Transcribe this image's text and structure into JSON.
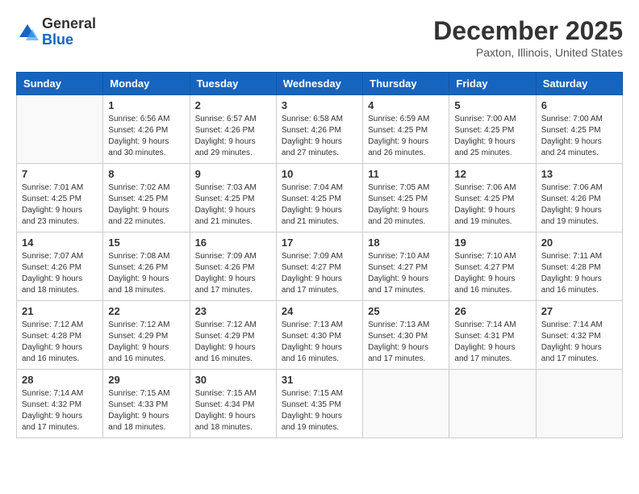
{
  "header": {
    "logo_line1": "General",
    "logo_line2": "Blue",
    "month": "December 2025",
    "location": "Paxton, Illinois, United States"
  },
  "days_of_week": [
    "Sunday",
    "Monday",
    "Tuesday",
    "Wednesday",
    "Thursday",
    "Friday",
    "Saturday"
  ],
  "weeks": [
    [
      {
        "day": "",
        "sunrise": "",
        "sunset": "",
        "daylight": "",
        "empty": true
      },
      {
        "day": "1",
        "sunrise": "6:56 AM",
        "sunset": "4:26 PM",
        "daylight": "9 hours and 30 minutes."
      },
      {
        "day": "2",
        "sunrise": "6:57 AM",
        "sunset": "4:26 PM",
        "daylight": "9 hours and 29 minutes."
      },
      {
        "day": "3",
        "sunrise": "6:58 AM",
        "sunset": "4:26 PM",
        "daylight": "9 hours and 27 minutes."
      },
      {
        "day": "4",
        "sunrise": "6:59 AM",
        "sunset": "4:25 PM",
        "daylight": "9 hours and 26 minutes."
      },
      {
        "day": "5",
        "sunrise": "7:00 AM",
        "sunset": "4:25 PM",
        "daylight": "9 hours and 25 minutes."
      },
      {
        "day": "6",
        "sunrise": "7:00 AM",
        "sunset": "4:25 PM",
        "daylight": "9 hours and 24 minutes."
      }
    ],
    [
      {
        "day": "7",
        "sunrise": "7:01 AM",
        "sunset": "4:25 PM",
        "daylight": "9 hours and 23 minutes."
      },
      {
        "day": "8",
        "sunrise": "7:02 AM",
        "sunset": "4:25 PM",
        "daylight": "9 hours and 22 minutes."
      },
      {
        "day": "9",
        "sunrise": "7:03 AM",
        "sunset": "4:25 PM",
        "daylight": "9 hours and 21 minutes."
      },
      {
        "day": "10",
        "sunrise": "7:04 AM",
        "sunset": "4:25 PM",
        "daylight": "9 hours and 21 minutes."
      },
      {
        "day": "11",
        "sunrise": "7:05 AM",
        "sunset": "4:25 PM",
        "daylight": "9 hours and 20 minutes."
      },
      {
        "day": "12",
        "sunrise": "7:06 AM",
        "sunset": "4:25 PM",
        "daylight": "9 hours and 19 minutes."
      },
      {
        "day": "13",
        "sunrise": "7:06 AM",
        "sunset": "4:26 PM",
        "daylight": "9 hours and 19 minutes."
      }
    ],
    [
      {
        "day": "14",
        "sunrise": "7:07 AM",
        "sunset": "4:26 PM",
        "daylight": "9 hours and 18 minutes."
      },
      {
        "day": "15",
        "sunrise": "7:08 AM",
        "sunset": "4:26 PM",
        "daylight": "9 hours and 18 minutes."
      },
      {
        "day": "16",
        "sunrise": "7:09 AM",
        "sunset": "4:26 PM",
        "daylight": "9 hours and 17 minutes."
      },
      {
        "day": "17",
        "sunrise": "7:09 AM",
        "sunset": "4:27 PM",
        "daylight": "9 hours and 17 minutes."
      },
      {
        "day": "18",
        "sunrise": "7:10 AM",
        "sunset": "4:27 PM",
        "daylight": "9 hours and 17 minutes."
      },
      {
        "day": "19",
        "sunrise": "7:10 AM",
        "sunset": "4:27 PM",
        "daylight": "9 hours and 16 minutes."
      },
      {
        "day": "20",
        "sunrise": "7:11 AM",
        "sunset": "4:28 PM",
        "daylight": "9 hours and 16 minutes."
      }
    ],
    [
      {
        "day": "21",
        "sunrise": "7:12 AM",
        "sunset": "4:28 PM",
        "daylight": "9 hours and 16 minutes."
      },
      {
        "day": "22",
        "sunrise": "7:12 AM",
        "sunset": "4:29 PM",
        "daylight": "9 hours and 16 minutes."
      },
      {
        "day": "23",
        "sunrise": "7:12 AM",
        "sunset": "4:29 PM",
        "daylight": "9 hours and 16 minutes."
      },
      {
        "day": "24",
        "sunrise": "7:13 AM",
        "sunset": "4:30 PM",
        "daylight": "9 hours and 16 minutes."
      },
      {
        "day": "25",
        "sunrise": "7:13 AM",
        "sunset": "4:30 PM",
        "daylight": "9 hours and 17 minutes."
      },
      {
        "day": "26",
        "sunrise": "7:14 AM",
        "sunset": "4:31 PM",
        "daylight": "9 hours and 17 minutes."
      },
      {
        "day": "27",
        "sunrise": "7:14 AM",
        "sunset": "4:32 PM",
        "daylight": "9 hours and 17 minutes."
      }
    ],
    [
      {
        "day": "28",
        "sunrise": "7:14 AM",
        "sunset": "4:32 PM",
        "daylight": "9 hours and 17 minutes."
      },
      {
        "day": "29",
        "sunrise": "7:15 AM",
        "sunset": "4:33 PM",
        "daylight": "9 hours and 18 minutes."
      },
      {
        "day": "30",
        "sunrise": "7:15 AM",
        "sunset": "4:34 PM",
        "daylight": "9 hours and 18 minutes."
      },
      {
        "day": "31",
        "sunrise": "7:15 AM",
        "sunset": "4:35 PM",
        "daylight": "9 hours and 19 minutes."
      },
      {
        "day": "",
        "sunrise": "",
        "sunset": "",
        "daylight": "",
        "empty": true
      },
      {
        "day": "",
        "sunrise": "",
        "sunset": "",
        "daylight": "",
        "empty": true
      },
      {
        "day": "",
        "sunrise": "",
        "sunset": "",
        "daylight": "",
        "empty": true
      }
    ]
  ],
  "labels": {
    "sunrise_prefix": "Sunrise: ",
    "sunset_prefix": "Sunset: ",
    "daylight_prefix": "Daylight: "
  }
}
